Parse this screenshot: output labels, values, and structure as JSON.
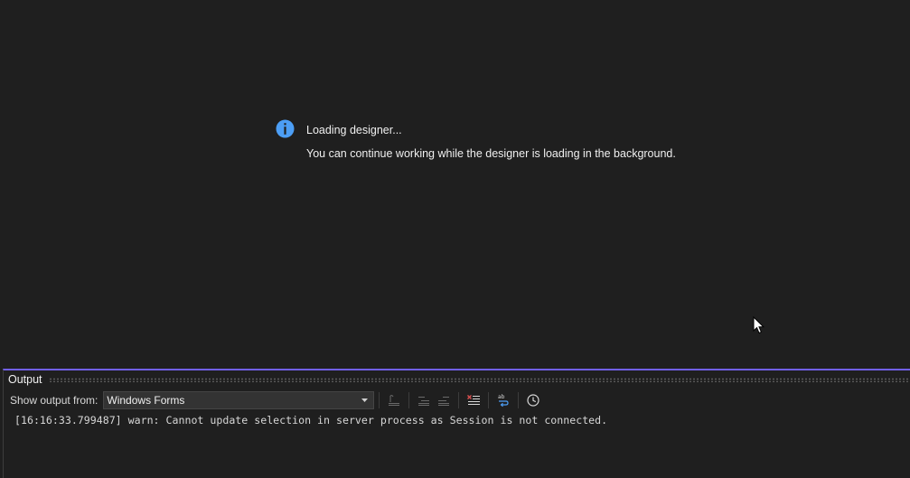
{
  "designer": {
    "loading_title": "Loading designer...",
    "loading_body": "You can continue working while the designer is loading in the background.",
    "info_icon": "info-icon",
    "info_color": "#4c9ef5"
  },
  "output_panel": {
    "title": "Output",
    "show_output_label": "Show output from:",
    "source_selected": "Windows Forms",
    "accent_color": "#7160e8",
    "toolbar_icons": [
      "find-message-in-code-icon",
      "previous-message-icon",
      "next-message-icon",
      "clear-all-icon",
      "toggle-word-wrap-icon",
      "toggle-timestamp-icon"
    ],
    "lines": [
      "[16:16:33.799487] warn: Cannot update selection in server process as Session is not connected."
    ]
  }
}
